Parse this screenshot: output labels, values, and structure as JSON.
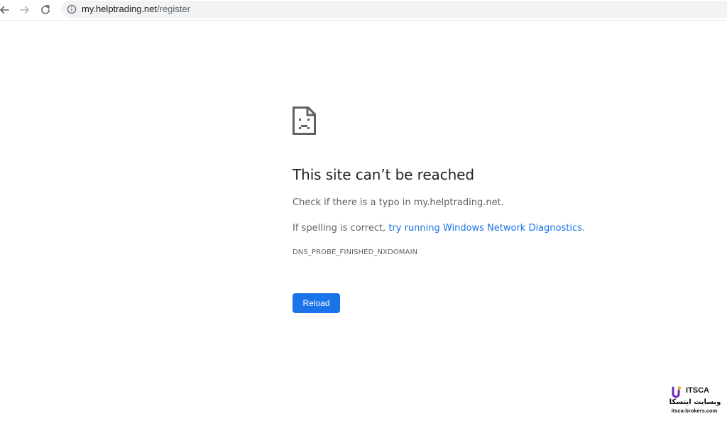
{
  "browser": {
    "back_icon": "arrow-left-icon",
    "forward_icon": "arrow-right-icon",
    "reload_icon": "refresh-icon",
    "site_info_icon": "info-icon",
    "url_host": "my.helptrading.net",
    "url_path": "/register"
  },
  "error_page": {
    "icon": "sad-page-icon",
    "title": "This site can’t be reached",
    "typo_text": "Check if there is a typo in my.helptrading.net.",
    "spelling_prefix": "If spelling is correct, ",
    "diagnostics_link": "try running Windows Network Diagnostics",
    "spelling_suffix": ".",
    "error_code": "DNS_PROBE_FINISHED_NXDOMAIN",
    "reload_label": "Reload"
  },
  "watermark": {
    "brand": "ITSCA",
    "persian_text": "وبسایت ایتسکا",
    "site": "itsca-brokers.com"
  },
  "colors": {
    "accent": "#1a73e8",
    "text": "#202124",
    "secondary_text": "#5f6368",
    "omnibox_bg": "#f1f3f4"
  }
}
